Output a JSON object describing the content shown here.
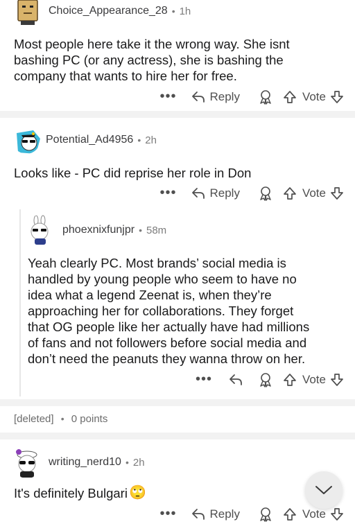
{
  "comments": [
    {
      "username": "Choice_Appearance_28",
      "time": "1h",
      "text_lines": [
        "Most people here take it the wrong way. She isnt",
        "bashing PC (or any actress), she is bashing the",
        "company that wants to hire her for free."
      ],
      "reply_label": "Reply",
      "vote_label": "Vote",
      "more_label": "•••"
    },
    {
      "username": "Potential_Ad4956",
      "time": "2h",
      "text_lines": [
        "Looks like - PC did reprise her role in Don"
      ],
      "reply_label": "Reply",
      "vote_label": "Vote",
      "more_label": "•••"
    },
    {
      "username": "phoexnixfunjpr",
      "time": "58m",
      "text_lines": [
        "Yeah clearly PC. Most brands’ social media is",
        "handled by young people who seem to have no",
        "idea what a legend Zeenat is, when they’re",
        "approaching her for collaborations. They forget",
        "that OG people like her actually have had millions",
        "of fans and not followers before social media and",
        "don’t need the peanuts they wanna throw on her."
      ],
      "vote_label": "Vote",
      "more_label": "•••"
    },
    {
      "username": "writing_nerd10",
      "time": "2h",
      "text": "It's definitely Bulgari",
      "emoji": "🙄",
      "reply_label": "Reply",
      "vote_label": "Vote",
      "more_label": "•••"
    }
  ],
  "deleted": {
    "label": "[deleted]",
    "points": "0 points"
  },
  "separator_dot": "•",
  "colors": {
    "separator": "#f2f2f2",
    "text": "#1a1a1b",
    "muted": "#7c7c7c"
  },
  "icons": [
    "reply-icon",
    "award-icon",
    "upvote-icon",
    "downvote-icon",
    "chevron-down-icon"
  ]
}
